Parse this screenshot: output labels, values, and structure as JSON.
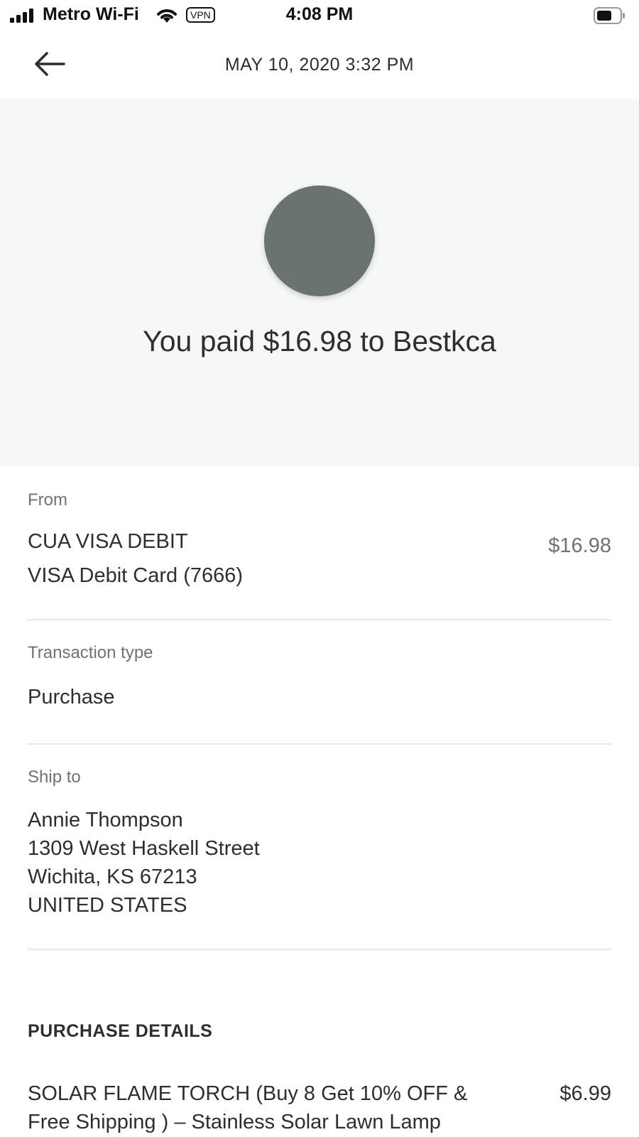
{
  "status_bar": {
    "carrier": "Metro Wi-Fi",
    "vpn": "VPN",
    "time": "4:08 PM"
  },
  "nav": {
    "title": "MAY 10, 2020  3:32 PM",
    "back_icon": "arrow-left-icon"
  },
  "hero": {
    "text": "You paid $16.98 to Bestkca",
    "avatar_color": "#6b7274",
    "background": "#f5f7fa"
  },
  "from": {
    "label": "From",
    "line1": "CUA VISA DEBIT",
    "line2": "VISA Debit Card (7666)",
    "amount": "$16.98"
  },
  "transaction": {
    "label": "Transaction type",
    "value": "Purchase"
  },
  "ship_to": {
    "label": "Ship to",
    "lines": [
      "Annie  Thompson",
      "1309 West Haskell Street",
      "Wichita, KS 67213",
      "UNITED STATES"
    ]
  },
  "purchase_details": {
    "header": "PURCHASE DETAILS",
    "items": [
      {
        "description": "SOLAR FLAME TORCH (Buy 8 Get 10% OFF & Free Shipping ) – Stainless Solar Lawn Lamp",
        "price": "$6.99"
      }
    ]
  }
}
